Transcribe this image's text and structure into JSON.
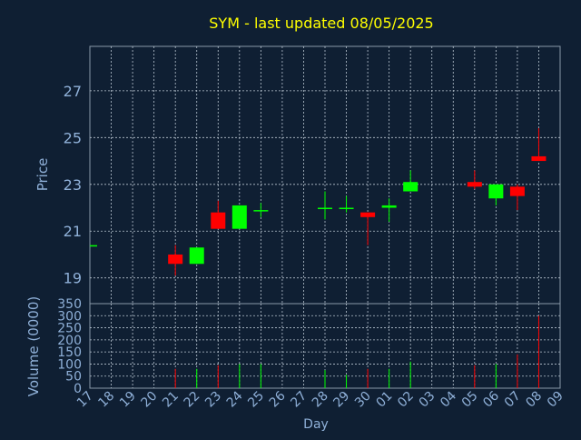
{
  "title": "SYM - last updated 08/05/2025",
  "colors": {
    "background": "#0f1f33",
    "axis": "#8a9aaa",
    "grid": "#b8c4d0",
    "text": "#8fb0d8",
    "title": "#ffff00",
    "up": "#00ff00",
    "down": "#ff0000"
  },
  "chart_data": {
    "type": "candlestick",
    "title": "SYM - last updated 08/05/2025",
    "xlabel": "Day",
    "x_tick_labels": [
      "17",
      "18",
      "19",
      "20",
      "21",
      "22",
      "23",
      "24",
      "25",
      "26",
      "27",
      "28",
      "29",
      "30",
      "01",
      "02",
      "03",
      "04",
      "05",
      "06",
      "07",
      "08",
      "09"
    ],
    "price_panel": {
      "ylabel": "Price",
      "yticks": [
        19,
        21,
        23,
        25,
        27
      ],
      "ylim": [
        17.9,
        28.9
      ],
      "grid": true
    },
    "volume_panel": {
      "ylabel": "Volume (0000)",
      "yticks": [
        0,
        50,
        100,
        150,
        200,
        250,
        300,
        350
      ],
      "ylim": [
        0,
        350
      ],
      "grid": true
    },
    "candles": [
      {
        "day": "17",
        "open": 20.4,
        "high": 20.4,
        "low": 20.4,
        "close": 20.4,
        "volume": 0
      },
      {
        "day": "21",
        "open": 20.0,
        "high": 20.4,
        "low": 19.1,
        "close": 19.6,
        "volume": 80
      },
      {
        "day": "22",
        "open": 19.6,
        "high": 20.3,
        "low": 19.6,
        "close": 20.3,
        "volume": 80
      },
      {
        "day": "23",
        "open": 21.8,
        "high": 22.3,
        "low": 21.1,
        "close": 21.1,
        "volume": 95
      },
      {
        "day": "24",
        "open": 21.1,
        "high": 22.1,
        "low": 21.1,
        "close": 22.1,
        "volume": 100
      },
      {
        "day": "25",
        "open": 21.9,
        "high": 22.2,
        "low": 21.6,
        "close": 21.9,
        "volume": 100
      },
      {
        "day": "28",
        "open": 22.0,
        "high": 22.7,
        "low": 21.5,
        "close": 22.0,
        "volume": 75
      },
      {
        "day": "29",
        "open": 22.0,
        "high": 22.5,
        "low": 21.8,
        "close": 22.0,
        "volume": 55
      },
      {
        "day": "30",
        "open": 21.8,
        "high": 21.8,
        "low": 20.4,
        "close": 21.6,
        "volume": 80
      },
      {
        "day": "01",
        "open": 22.0,
        "high": 22.4,
        "low": 21.4,
        "close": 22.1,
        "volume": 80
      },
      {
        "day": "02",
        "open": 22.7,
        "high": 23.6,
        "low": 22.7,
        "close": 23.1,
        "volume": 110
      },
      {
        "day": "05",
        "open": 23.1,
        "high": 23.6,
        "low": 22.8,
        "close": 22.9,
        "volume": 95
      },
      {
        "day": "06",
        "open": 22.4,
        "high": 23.0,
        "low": 22.1,
        "close": 23.0,
        "volume": 100
      },
      {
        "day": "07",
        "open": 22.9,
        "high": 23.0,
        "low": 21.9,
        "close": 22.5,
        "volume": 140
      },
      {
        "day": "08",
        "open": 24.2,
        "high": 25.4,
        "low": 24.0,
        "close": 24.0,
        "volume": 300
      }
    ]
  }
}
